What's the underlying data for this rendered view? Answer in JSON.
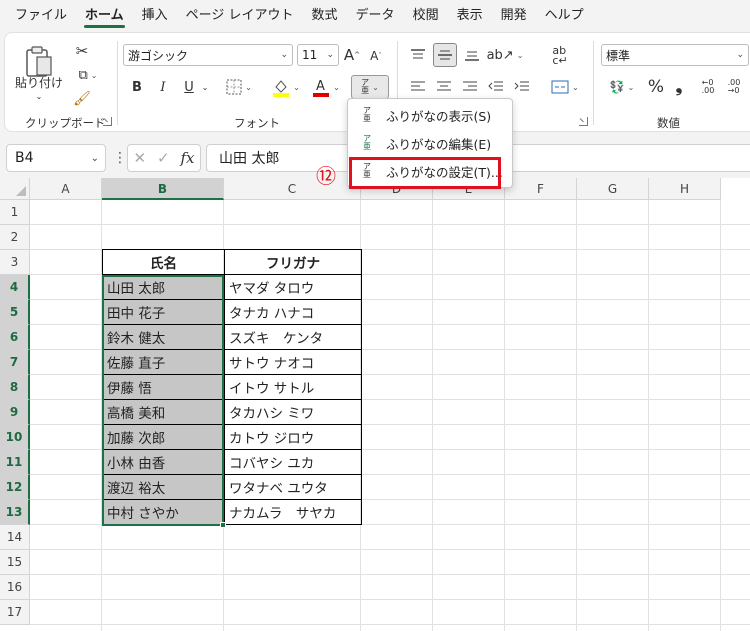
{
  "menubar": {
    "tabs": [
      "ファイル",
      "ホーム",
      "挿入",
      "ページ レイアウト",
      "数式",
      "データ",
      "校閲",
      "表示",
      "開発",
      "ヘルプ"
    ],
    "active": "ホーム"
  },
  "ribbon": {
    "clipboard": {
      "paste_label": "貼り付け",
      "group_label": "クリップボード"
    },
    "font": {
      "font_name": "游ゴシック",
      "font_size": "11",
      "bold": "B",
      "italic": "I",
      "underline": "U",
      "group_label": "フォント",
      "fill_color": "#ffff00",
      "font_color": "#e00000"
    },
    "number": {
      "format": "標準",
      "group_label": "数値",
      "percent": "%",
      "comma": "❟"
    }
  },
  "furigana_menu": {
    "items": [
      {
        "label": "ふりがなの表示(S)"
      },
      {
        "label": "ふりがなの編集(E)"
      },
      {
        "label": "ふりがなの設定(T)..."
      }
    ],
    "step_badge": "⑫"
  },
  "formula_bar": {
    "name_box": "B4",
    "formula": "山田 太郎",
    "fx": "fx"
  },
  "sheet": {
    "columns": [
      "A",
      "B",
      "C",
      "D",
      "E",
      "F",
      "G",
      "H"
    ],
    "rows": [
      "1",
      "2",
      "3",
      "4",
      "5",
      "6",
      "7",
      "8",
      "9",
      "10",
      "11",
      "12",
      "13",
      "14",
      "15",
      "16",
      "17"
    ],
    "table": {
      "headers": [
        "氏名",
        "フリガナ"
      ],
      "rows": [
        [
          "山田 太郎",
          "ヤマダ タロウ"
        ],
        [
          "田中 花子",
          "タナカ ハナコ"
        ],
        [
          "鈴木 健太",
          "スズキ　ケンタ"
        ],
        [
          "佐藤 直子",
          "サトウ ナオコ"
        ],
        [
          "伊藤 悟",
          "イトウ サトル"
        ],
        [
          "高橋 美和",
          "タカハシ ミワ"
        ],
        [
          "加藤 次郎",
          "カトウ ジロウ"
        ],
        [
          "小林 由香",
          "コバヤシ ユカ"
        ],
        [
          "渡辺 裕太",
          "ワタナベ ユウタ"
        ],
        [
          "中村 さやか",
          "ナカムラ　サヤカ"
        ]
      ]
    },
    "selection_color": "#1e7145"
  }
}
